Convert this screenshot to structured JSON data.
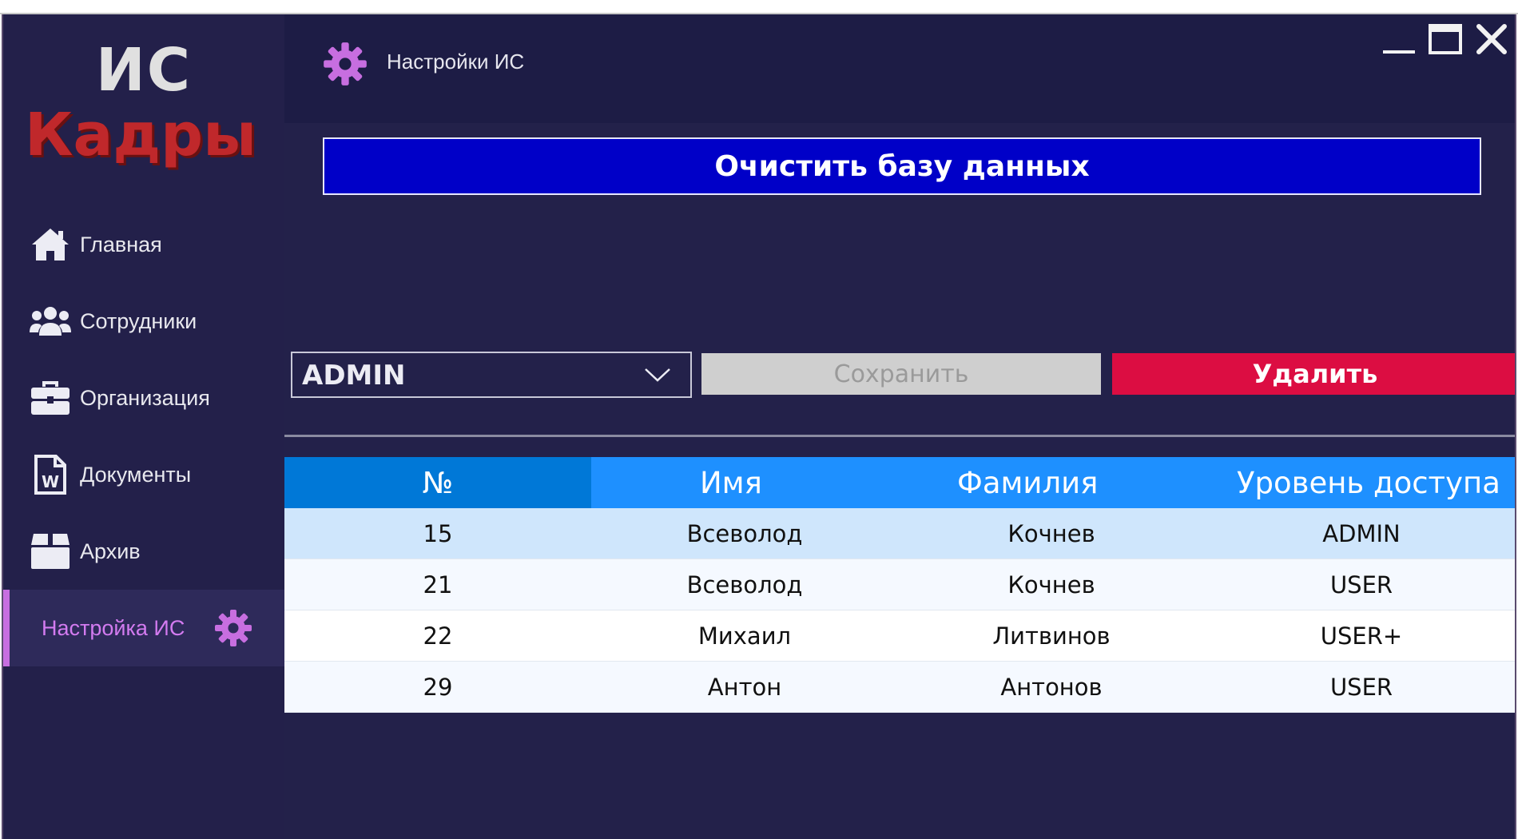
{
  "logo": {
    "line1": "ИС",
    "line2": "Кадры"
  },
  "sidebar": {
    "items": [
      {
        "label": "Главная",
        "icon": "home-icon"
      },
      {
        "label": "Сотрудники",
        "icon": "users-icon"
      },
      {
        "label": "Организация",
        "icon": "briefcase-icon"
      },
      {
        "label": "Документы",
        "icon": "word-document-icon"
      },
      {
        "label": "Архив",
        "icon": "archive-box-icon"
      },
      {
        "label": "Настройка ИС",
        "icon": "gear-icon",
        "active": true
      }
    ]
  },
  "header": {
    "title": "Настройки ИС",
    "icon": "gear-icon"
  },
  "window_controls": {
    "minimize": "minimize-icon",
    "maximize": "maximize-icon",
    "close": "close-icon"
  },
  "main": {
    "clear_db_label": "Очистить базу данных",
    "role_select_value": "ADMIN",
    "save_label": "Сохранить",
    "delete_label": "Удалить"
  },
  "table": {
    "headers": [
      "№",
      "Имя",
      "Фамилия",
      "Уровень доступа"
    ],
    "rows": [
      [
        "15",
        "Всеволод",
        "Кочнев",
        "ADMIN"
      ],
      [
        "21",
        "Всеволод",
        "Кочнев",
        "USER"
      ],
      [
        "22",
        "Михаил",
        "Литвинов",
        "USER+"
      ],
      [
        "29",
        "Антон",
        "Антонов",
        "USER"
      ]
    ]
  },
  "colors": {
    "accent": "#d37bf0",
    "clear_button": "#0000c8",
    "delete_button": "#dc0d42",
    "table_header": "#1e90ff",
    "sidebar_bg": "#23204a"
  }
}
